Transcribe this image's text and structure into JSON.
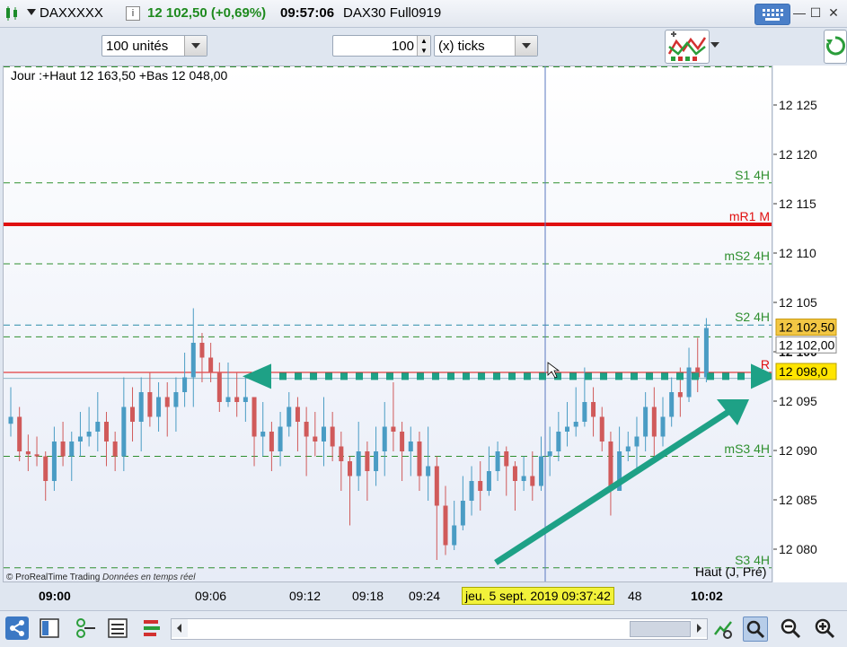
{
  "window": {
    "symbol": "DAXXXXX",
    "info_glyph": "i",
    "price_change": "12 102,50 (+0,69%)",
    "time": "09:57:06",
    "instrument": "DAX30 Full0919",
    "controls": [
      "—",
      "☐",
      "✕"
    ]
  },
  "toolbar": {
    "units_select": "100 unités",
    "quantity_value": "100",
    "ticks_select": "(x) ticks"
  },
  "chart": {
    "header": "Jour :+Haut 12 163,50 +Bas 12 048,00",
    "copyright": "© ProRealTime Trading",
    "copyright_note": "Données en temps réel",
    "corner_label": "Haut (J, Pré)",
    "level_labels": {
      "s1_4h": "S1 4H",
      "mr1_m": "mR1 M",
      "ms2_4h": "mS2 4H",
      "s2_4h": "S2 4H",
      "r_label": "R",
      "ms3_4h": "mS3 4H",
      "s3_4h": "S3 4H"
    },
    "colors": {
      "bull": "#4a9cc4",
      "bear": "#d05a5a",
      "pivot_red": "#e01010",
      "pivot_green": "#2f8f2f",
      "dashed_blue": "#2b8ca8",
      "arrow_teal": "#1ea186",
      "price_marker": "#ffd800",
      "cursor_tooltip": "#f2f23a"
    }
  },
  "price_axis": {
    "ticks": [
      "12 125",
      "12 120",
      "12 115",
      "12 110",
      "12 105",
      "12 100",
      "12 095",
      "12 090",
      "12 085",
      "12 080"
    ],
    "bold_tick": "12 100",
    "markers": {
      "last": "12 102,50",
      "bid": "12 102,00",
      "level": "12 098,0"
    }
  },
  "time_axis": {
    "labels": [
      "09:00",
      "09:06",
      "09:12",
      "09:18",
      "09:24",
      "48",
      "10:02"
    ],
    "cursor_label": "jeu. 5 sept. 2019 09:37:42"
  },
  "chart_data": {
    "type": "candlestick",
    "instrument": "DAX30 Full0919",
    "y_range": [
      12077,
      12130
    ],
    "x_range": [
      "09:00",
      "10:02"
    ],
    "candles": [
      [
        12092.8,
        12093.5,
        12096.5,
        12091.5
      ],
      [
        12093.5,
        12090.0,
        12094.5,
        12089.0
      ],
      [
        12090.0,
        12089.7,
        12091.7,
        12088.0
      ],
      [
        12089.7,
        12089.5,
        12091.5,
        12088.5
      ],
      [
        12089.5,
        12087.0,
        12090.0,
        12085.0
      ],
      [
        12087.0,
        12091.0,
        12092.5,
        12086.0
      ],
      [
        12091.0,
        12089.5,
        12093.0,
        12088.5
      ],
      [
        12089.5,
        12091.0,
        12092.0,
        12087.0
      ],
      [
        12091.0,
        12091.5,
        12094.0,
        12089.5
      ],
      [
        12091.5,
        12092.0,
        12094.5,
        12090.5
      ],
      [
        12092.0,
        12093.0,
        12096.0,
        12090.0
      ],
      [
        12093.0,
        12091.0,
        12094.0,
        12088.5
      ],
      [
        12091.0,
        12089.5,
        12092.0,
        12088.0
      ],
      [
        12089.5,
        12094.5,
        12097.5,
        12088.0
      ],
      [
        12094.5,
        12093.0,
        12096.5,
        12091.0
      ],
      [
        12093.0,
        12096.0,
        12097.5,
        12090.0
      ],
      [
        12096.0,
        12093.5,
        12098.0,
        12092.5
      ],
      [
        12093.5,
        12095.5,
        12097.0,
        12092.0
      ],
      [
        12095.5,
        12094.5,
        12097.0,
        12091.5
      ],
      [
        12094.5,
        12096.0,
        12097.5,
        12092.0
      ],
      [
        12096.0,
        12097.5,
        12100.0,
        12094.5
      ],
      [
        12097.5,
        12101.0,
        12104.5,
        12094.5
      ],
      [
        12101.0,
        12099.5,
        12102.0,
        12097.0
      ],
      [
        12099.5,
        12098.0,
        12101.0,
        12097.0
      ],
      [
        12098.0,
        12095.0,
        12099.0,
        12094.0
      ],
      [
        12095.0,
        12095.5,
        12099.0,
        12094.5
      ],
      [
        12095.5,
        12095.0,
        12098.0,
        12093.5
      ],
      [
        12095.0,
        12095.5,
        12097.5,
        12093.0
      ],
      [
        12095.5,
        12091.5,
        12095.5,
        12088.5
      ],
      [
        12091.5,
        12092.0,
        12095.0,
        12089.5
      ],
      [
        12092.0,
        12090.0,
        12093.0,
        12088.0
      ],
      [
        12090.0,
        12092.5,
        12094.0,
        12088.5
      ],
      [
        12092.5,
        12094.5,
        12096.0,
        12091.5
      ],
      [
        12094.5,
        12093.0,
        12095.5,
        12090.0
      ],
      [
        12093.0,
        12091.5,
        12094.5,
        12087.5
      ],
      [
        12091.5,
        12091.0,
        12094.0,
        12089.5
      ],
      [
        12091.0,
        12092.5,
        12095.5,
        12088.5
      ],
      [
        12092.5,
        12090.5,
        12094.0,
        12089.0
      ],
      [
        12090.5,
        12089.0,
        12092.0,
        12086.0
      ],
      [
        12089.0,
        12087.5,
        12089.5,
        12082.5
      ],
      [
        12087.5,
        12090.0,
        12093.0,
        12086.0
      ],
      [
        12090.0,
        12088.0,
        12091.0,
        12085.0
      ],
      [
        12088.0,
        12090.0,
        12092.5,
        12086.5
      ],
      [
        12090.0,
        12092.5,
        12095.0,
        12087.5
      ],
      [
        12092.5,
        12092.0,
        12097.0,
        12090.0
      ],
      [
        12092.0,
        12090.0,
        12093.0,
        12087.0
      ],
      [
        12090.0,
        12091.0,
        12092.5,
        12087.5
      ],
      [
        12091.0,
        12087.5,
        12092.0,
        12086.0
      ],
      [
        12087.5,
        12088.5,
        12092.5,
        12085.0
      ],
      [
        12088.5,
        12084.5,
        12089.5,
        12079.0
      ],
      [
        12084.5,
        12080.5,
        12086.5,
        12079.5
      ],
      [
        12080.5,
        12082.5,
        12085.0,
        12080.0
      ],
      [
        12082.5,
        12085.0,
        12087.5,
        12082.0
      ],
      [
        12085.0,
        12087.0,
        12088.5,
        12083.5
      ],
      [
        12087.0,
        12086.0,
        12089.0,
        12084.0
      ],
      [
        12086.0,
        12088.0,
        12090.5,
        12085.5
      ],
      [
        12088.0,
        12090.0,
        12091.0,
        12087.0
      ],
      [
        12090.0,
        12088.5,
        12090.5,
        12085.5
      ],
      [
        12088.5,
        12087.0,
        12089.0,
        12084.0
      ],
      [
        12087.0,
        12087.5,
        12089.5,
        12086.0
      ],
      [
        12087.5,
        12086.5,
        12090.0,
        12085.0
      ],
      [
        12086.5,
        12089.5,
        12091.5,
        12086.0
      ],
      [
        12089.5,
        12090.0,
        12092.5,
        12087.5
      ],
      [
        12090.0,
        12092.0,
        12094.0,
        12089.0
      ],
      [
        12092.0,
        12092.5,
        12095.0,
        12090.5
      ],
      [
        12092.5,
        12093.0,
        12096.5,
        12091.5
      ],
      [
        12093.0,
        12095.0,
        12098.5,
        12092.5
      ],
      [
        12095.0,
        12093.5,
        12096.5,
        12091.5
      ],
      [
        12093.5,
        12091.0,
        12094.5,
        12090.0
      ],
      [
        12091.0,
        12086.0,
        12092.0,
        12083.5
      ],
      [
        12086.0,
        12090.0,
        12092.5,
        12086.5
      ],
      [
        12090.0,
        12090.5,
        12092.0,
        12089.0
      ],
      [
        12090.5,
        12091.5,
        12093.5,
        12088.0
      ],
      [
        12091.5,
        12094.5,
        12096.0,
        12090.0
      ],
      [
        12094.5,
        12091.5,
        12096.5,
        12089.0
      ],
      [
        12091.5,
        12093.5,
        12095.5,
        12090.5
      ],
      [
        12093.5,
        12096.0,
        12097.5,
        12092.5
      ],
      [
        12096.0,
        12095.5,
        12098.5,
        12093.5
      ],
      [
        12095.5,
        12098.5,
        12100.5,
        12095.0
      ],
      [
        12098.5,
        12097.5,
        12101.5,
        12096.0
      ],
      [
        12097.5,
        12102.5,
        12103.5,
        12097.0
      ]
    ],
    "levels": [
      {
        "name": "S1 4H",
        "value": 12117.2
      },
      {
        "name": "mR1 M",
        "value": 12113.0
      },
      {
        "name": "mS2 4H",
        "value": 12109.0
      },
      {
        "name": "S2 4H",
        "value": 12102.8
      },
      {
        "name": "",
        "value": 12101.6
      },
      {
        "name": "R",
        "value": 12098.0
      },
      {
        "name": "",
        "value": 12097.4
      },
      {
        "name": "mS3 4H",
        "value": 12089.5
      },
      {
        "name": "S3 4H",
        "value": 12078.2
      }
    ],
    "drawn_support": 12097.6
  }
}
